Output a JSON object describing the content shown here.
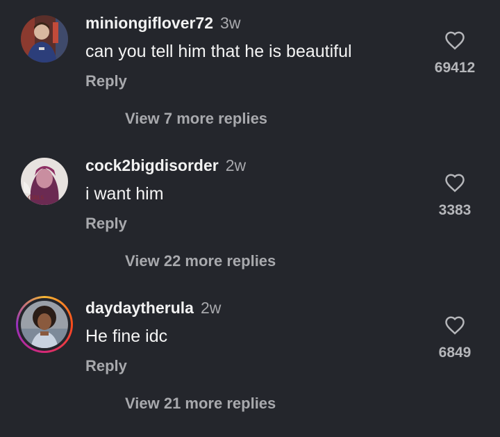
{
  "colors": {
    "background": "#24262c",
    "primary_text": "#f2f2f2",
    "secondary_text": "#a8a9ad",
    "story_ring": [
      "#f7b733",
      "#fc4a1a",
      "#d62976",
      "#962fbf"
    ]
  },
  "comments": [
    {
      "username": "miniongiflover72",
      "time": "3w",
      "text": "can you tell him that he is beautiful",
      "reply_label": "Reply",
      "likes": "69412",
      "view_replies": "View 7 more replies",
      "avatar_icon": "avatar-photo-icon",
      "has_story_ring": false
    },
    {
      "username": "cock2bigdisorder",
      "time": "2w",
      "text": "i want him",
      "reply_label": "Reply",
      "likes": "3383",
      "view_replies": "View 22 more replies",
      "avatar_icon": "avatar-photo-icon",
      "has_story_ring": false
    },
    {
      "username": "daydaytherula",
      "time": "2w",
      "text": "He fine idc",
      "reply_label": "Reply",
      "likes": "6849",
      "view_replies": "View 21 more replies",
      "avatar_icon": "avatar-photo-icon",
      "has_story_ring": true
    }
  ]
}
